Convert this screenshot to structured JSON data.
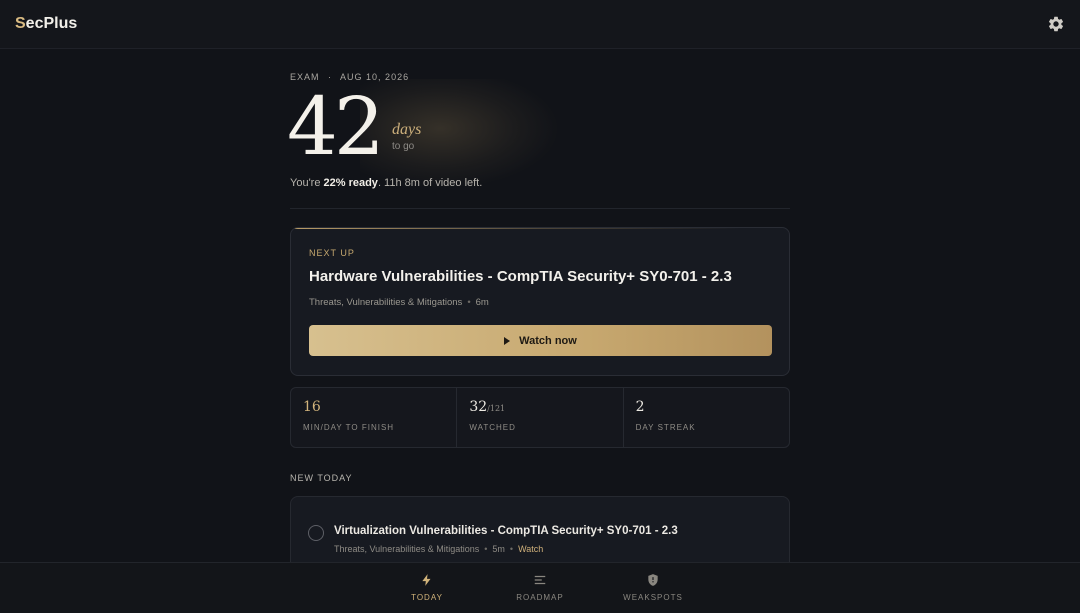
{
  "app": {
    "logo_first": "S",
    "logo_rest": "ecPlus",
    "settings_icon": "gear-icon"
  },
  "exam": {
    "label": "EXAM",
    "separator": "·",
    "date": "AUG 10, 2026",
    "days_left": "42",
    "days_word": "days",
    "to_go": "to go",
    "ready_prefix": "You're ",
    "ready_value": "22% ready",
    "ready_suffix": ". 11h 8m of video left."
  },
  "next_up": {
    "eyebrow": "NEXT UP",
    "title": "Hardware Vulnerabilities - CompTIA Security+ SY0-701 - 2.3",
    "category": "Threats, Vulnerabilities & Mitigations",
    "duration": "6m",
    "button_label": "Watch now"
  },
  "stats": [
    {
      "value": "16",
      "sub": "",
      "label": "MIN/DAY TO FINISH"
    },
    {
      "value": "32",
      "sub": "/121",
      "label": "WATCHED"
    },
    {
      "value": "2",
      "sub": "",
      "label": "DAY STREAK"
    }
  ],
  "new_today": {
    "heading": "NEW TODAY",
    "items": [
      {
        "title": "Virtualization Vulnerabilities - CompTIA Security+ SY0-701 - 2.3",
        "category": "Threats, Vulnerabilities & Mitigations",
        "duration": "5m",
        "action": "Watch"
      }
    ]
  },
  "nav": {
    "items": [
      {
        "label": "TODAY",
        "icon": "lightning-icon",
        "active": true
      },
      {
        "label": "ROADMAP",
        "icon": "list-icon",
        "active": false
      },
      {
        "label": "WEAKSPOTS",
        "icon": "shield-icon",
        "active": false
      }
    ]
  },
  "colors": {
    "accent": "#c9a96e",
    "background": "#111318",
    "card": "#171a21"
  }
}
